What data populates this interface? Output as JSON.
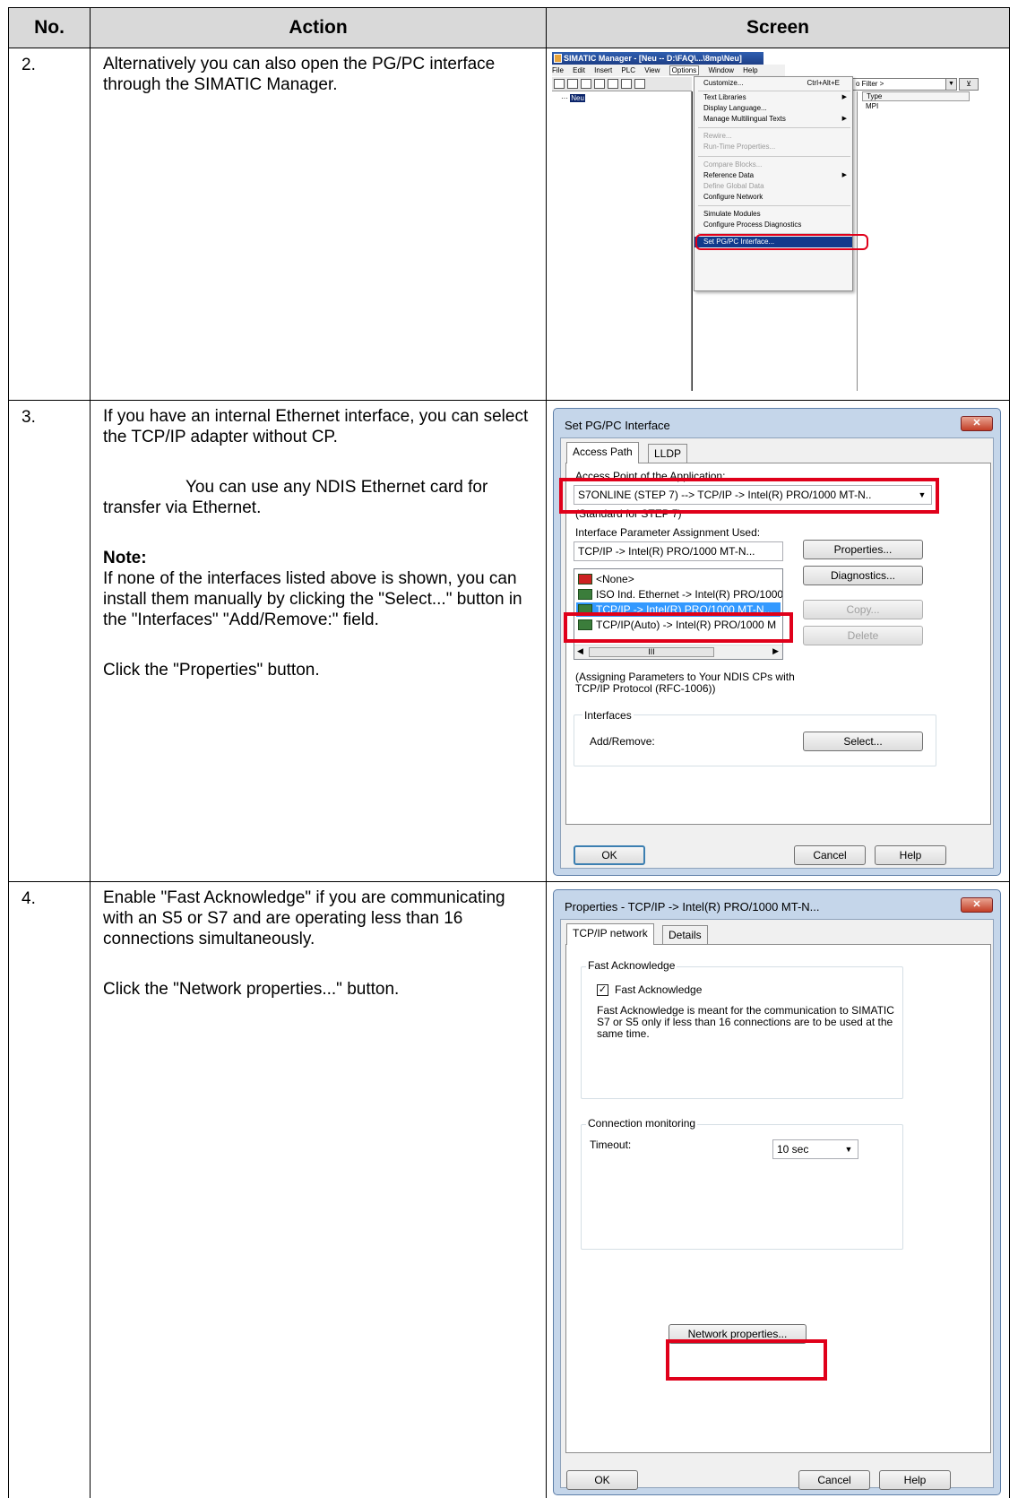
{
  "headers": {
    "no": "No.",
    "action": "Action",
    "screen": "Screen"
  },
  "rows": [
    {
      "no": "2.",
      "action": {
        "p1": "Alternatively you can also open the PG/PC interface through the SIMATIC Manager."
      }
    },
    {
      "no": "3.",
      "action": {
        "p1": "If you have an internal Ethernet interface, you can select the TCP/IP adapter without CP.",
        "p2": "You can use any NDIS Ethernet card for transfer via Ethernet.",
        "note_head": "Note:",
        "note_body": "If none of the interfaces listed above is shown, you can install them manually by clicking the \"Select...\" button in the \"Interfaces\" \"Add/Remove:\" field.",
        "p3": "Click the \"Properties\" button."
      }
    },
    {
      "no": "4.",
      "action": {
        "p1": "Enable \"Fast Acknowledge\" if you are communicating with an S5 or S7 and are operating less than 16 connections simultaneously.",
        "p2": "Click the \"Network properties...\" button."
      }
    }
  ],
  "screen_simatic": {
    "title": "SIMATIC Manager - [Neu -- D:\\FAQ\\...\\8mp\\Neu]",
    "menu": [
      "File",
      "Edit",
      "Insert",
      "PLC",
      "View",
      "Options",
      "Window",
      "Help"
    ],
    "tree_item": "Neu",
    "filter": "o Filter >",
    "column_type": "Type",
    "type_value": "MPI",
    "dropdown": {
      "customize": "Customize...",
      "customize_shortcut": "Ctrl+Alt+E",
      "text_libraries": "Text Libraries",
      "display_language": "Display Language...",
      "manage_texts": "Manage Multilingual Texts",
      "rewire": "Rewire...",
      "runtime_props": "Run-Time Properties...",
      "compare_blocks": "Compare Blocks...",
      "reference_data": "Reference Data",
      "define_global": "Define Global Data",
      "configure_network": "Configure Network",
      "simulate": "Simulate Modules",
      "process_diag": "Configure Process Diagnostics",
      "set_pgpc": "Set PG/PC Interface..."
    }
  },
  "dialog_pgpc": {
    "title": "Set PG/PC Interface",
    "close": "✕",
    "tabs": [
      "Access Path",
      "LLDP"
    ],
    "access_point_label": "Access Point of the Application:",
    "access_point_value": "S7ONLINE     (STEP 7)      --> TCP/IP -> Intel(R) PRO/1000 MT-N..",
    "access_point_note": "(Standard for STEP 7)",
    "param_label": "Interface Parameter Assignment Used:",
    "param_value": "TCP/IP -> Intel(R) PRO/1000 MT-N...",
    "list": [
      "<None>",
      "ISO Ind. Ethernet -> Intel(R) PRO/1000",
      "TCP/IP -> Intel(R) PRO/1000 MT-N...",
      "TCP/IP(Auto) -> Intel(R) PRO/1000 M"
    ],
    "scroll_thumb": "III",
    "btn_properties": "Properties...",
    "btn_diagnostics": "Diagnostics...",
    "btn_copy": "Copy...",
    "btn_delete": "Delete",
    "assign_note": "(Assigning Parameters to Your NDIS CPs with TCP/IP Protocol (RFC-1006))",
    "interfaces_label": "Interfaces",
    "add_remove_label": "Add/Remove:",
    "btn_select": "Select...",
    "btn_ok": "OK",
    "btn_cancel": "Cancel",
    "btn_help": "Help"
  },
  "dialog_props": {
    "title": "Properties - TCP/IP -> Intel(R) PRO/1000 MT-N...",
    "close": "✕",
    "tabs": [
      "TCP/IP network",
      "Details"
    ],
    "fast_group": "Fast Acknowledge",
    "fast_check_label": "Fast Acknowledge",
    "fast_check_mark": "✓",
    "fast_desc": "Fast Acknowledge is meant for the communication to SIMATIC S7 or S5 only if less than 16 connections are to be used at the same time.",
    "conn_group": "Connection monitoring",
    "timeout_label": "Timeout:",
    "timeout_value": "10 sec",
    "btn_network": "Network properties...",
    "btn_ok": "OK",
    "btn_cancel": "Cancel",
    "btn_help": "Help"
  }
}
